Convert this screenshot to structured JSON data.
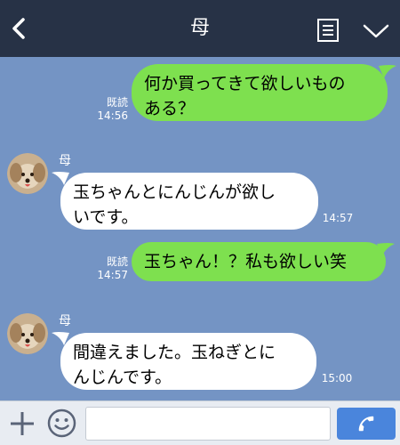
{
  "header": {
    "title": "母",
    "icons": [
      "chevron-left-icon",
      "note-icon",
      "chevron-down-icon"
    ]
  },
  "messages": [
    {
      "side": "right",
      "lines": [
        "何か買ってきて欲しいもの",
        "ある？"
      ],
      "read_label": "既読",
      "time": "14:56"
    },
    {
      "side": "left",
      "sender": "母",
      "lines": [
        "玉ちゃんとにんじんが欲し",
        "いです。"
      ],
      "time": "14:57"
    },
    {
      "side": "right",
      "lines": [
        "玉ちゃん！？私も欲しい笑"
      ],
      "read_label": "既読",
      "time": "14:57"
    },
    {
      "side": "left",
      "sender": "母",
      "lines": [
        "間違えました。玉ねぎとに",
        "んじんです。"
      ],
      "time": "15:00"
    }
  ],
  "input": {
    "placeholder": "",
    "value": ""
  },
  "colors": {
    "background": "#7494c4",
    "header": "#273246",
    "sent_bubble": "#7ee04f",
    "received_bubble": "#ffffff",
    "send_button": "#4a85dc"
  }
}
